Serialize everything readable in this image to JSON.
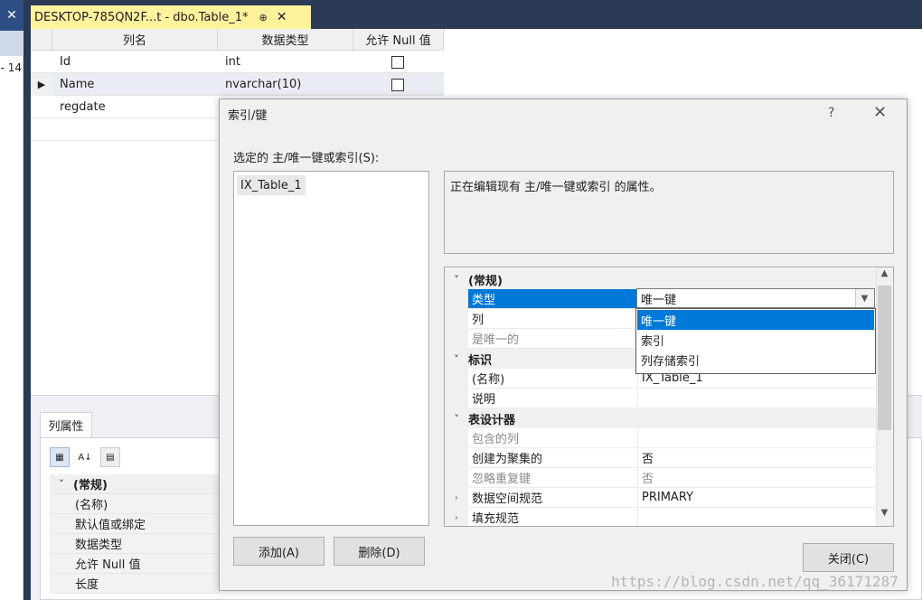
{
  "left_strip": {
    "close_glyph": "✕",
    "number": "- 14"
  },
  "doc_tab": {
    "title": "DESKTOP-785QN2F...t - dbo.Table_1*",
    "pin_glyph": "⊕",
    "close_glyph": "✕"
  },
  "grid": {
    "headers": [
      "列名",
      "数据类型",
      "允许 Null 值"
    ],
    "rows": [
      {
        "name": "Id",
        "type": "int",
        "selector": ""
      },
      {
        "name": "Name",
        "type": "nvarchar(10)",
        "selector": "▶"
      },
      {
        "name": "regdate",
        "type": "",
        "selector": ""
      }
    ]
  },
  "column_props": {
    "tab_label": "列属性",
    "category": "(常规)",
    "items": [
      "(名称)",
      "默认值或绑定",
      "数据类型",
      "允许 Null 值",
      "长度"
    ]
  },
  "dialog": {
    "title": "索引/键",
    "help_glyph": "?",
    "close_glyph": "✕",
    "selected_label": "选定的 主/唯一键或索引(S):",
    "index_items": [
      "IX_Table_1"
    ],
    "description": "正在编辑现有 主/唯一键或索引 的属性。",
    "properties": {
      "cat_general": "(常规)",
      "type_label": "类型",
      "type_value": "唯一键",
      "columns_label": "列",
      "is_unique_label": "是唯一的",
      "cat_identity": "标识",
      "name_label": "(名称)",
      "name_value": "IX_Table_1",
      "desc_label": "说明",
      "cat_table_designer": "表设计器",
      "included_cols_label": "包含的列",
      "create_clustered_label": "创建为聚集的",
      "create_clustered_value": "否",
      "ignore_dup_label": "忽略重复键",
      "ignore_dup_value": "否",
      "data_space_label": "数据空间规范",
      "data_space_value": "PRIMARY",
      "fill_spec_label": "填充规范"
    },
    "type_options": [
      "唯一键",
      "索引",
      "列存储索引"
    ],
    "buttons": {
      "add": "添加(A)",
      "delete": "删除(D)",
      "close": "关闭(C)"
    }
  },
  "watermark": "https://blog.csdn.net/qq_36171287",
  "colors": {
    "accent": "#0078d7",
    "tab_yellow": "#fff29d",
    "chrome_dark": "#2b3a55"
  }
}
